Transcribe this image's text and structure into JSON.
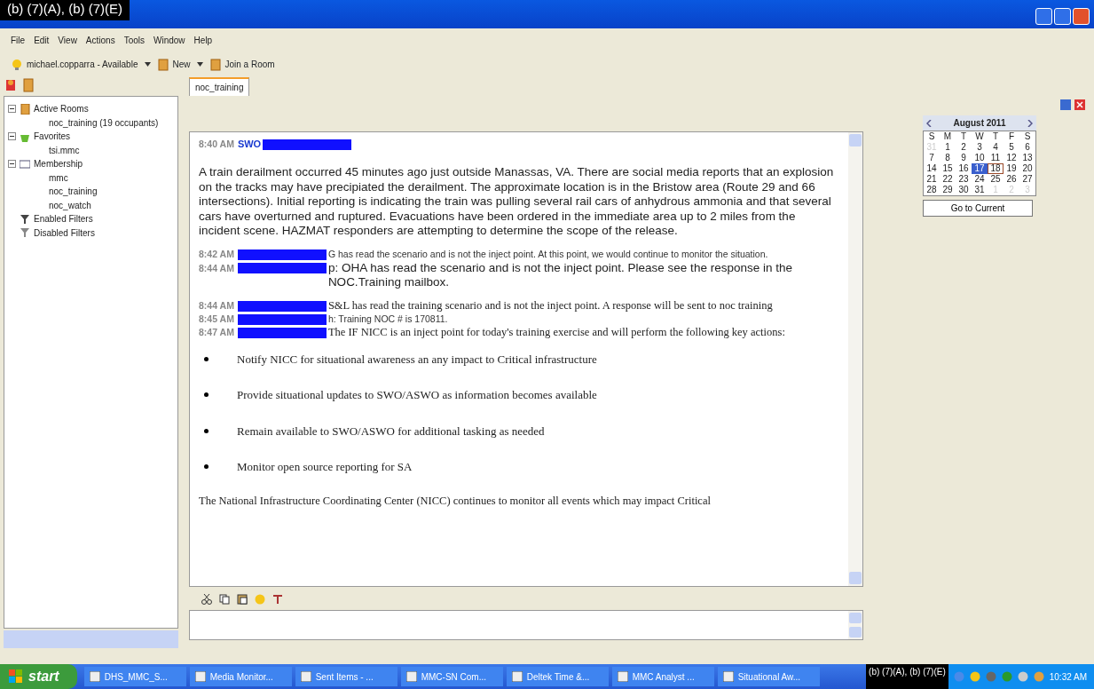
{
  "window": {
    "title_redaction": "(b) (7)(A), (b) (7)(E)"
  },
  "menu": [
    "File",
    "Edit",
    "View",
    "Actions",
    "Tools",
    "Window",
    "Help"
  ],
  "toolbar": {
    "status": "michael.copparra - Available",
    "buttons": [
      "New",
      "Join a Room"
    ]
  },
  "sidebar": {
    "tree": [
      {
        "label": "Active Rooms",
        "kind": "rooms",
        "expanded": true,
        "children": [
          {
            "label": "noc_training (19 occupants)"
          }
        ]
      },
      {
        "label": "Favorites",
        "kind": "favorites",
        "expanded": true,
        "children": [
          {
            "label": "tsi.mmc"
          }
        ]
      },
      {
        "label": "Membership",
        "kind": "membership",
        "expanded": true,
        "children": [
          {
            "label": "mmc"
          },
          {
            "label": "noc_training"
          },
          {
            "label": "noc_watch"
          }
        ]
      },
      {
        "label": "Enabled Filters",
        "kind": "filter"
      },
      {
        "label": "Disabled Filters",
        "kind": "filter-off"
      }
    ]
  },
  "room_tab": {
    "label": "noc_training",
    "selected": true
  },
  "messages": [
    {
      "time": "8:40 AM",
      "sender": "SWO",
      "kind": "header"
    },
    {
      "kind": "large",
      "text": "A train derailment occurred 45 minutes ago just outside Manassas, VA.  There are social media reports that an explosion on the tracks may have precipiated the derailment. The approximate location is in the Bristow area (Route 29 and 66 intersections).  Initial reporting is indicating the train was pulling several rail cars of anhydrous ammonia and that several cars have overturned and ruptured.  Evacuations have been ordered in the immediate area up to 2 miles from the incident scene. HAZMAT responders are attempting to determine the scope of the release."
    },
    {
      "time": "8:42 AM",
      "kind": "small",
      "text": "G has read the scenario and is not the inject point.  At this point, we would continue to monitor the situation."
    },
    {
      "time": "8:44 AM",
      "kind": "large",
      "text": "p: OHA has read the scenario and is not the inject point.  Please see the response in the NOC.Training mailbox."
    },
    {
      "time": "8:44 AM",
      "kind": "serif",
      "text": "S&L has read the training scenario and is not the inject point. A response will be sent to noc training"
    },
    {
      "time": "8:45 AM",
      "kind": "small",
      "text": "h: Training NOC # is 170811."
    },
    {
      "time": "8:47 AM",
      "kind": "serif",
      "text": "The IF NICC is an inject point for today's training exercise and will perform the following key actions:"
    },
    {
      "kind": "bullet",
      "text": "Notify NICC for situational awareness an any impact to Critical infrastructure"
    },
    {
      "kind": "bullet",
      "text": "Provide situational updates to SWO/ASWO as information becomes available"
    },
    {
      "kind": "bullet",
      "text": "Remain available to SWO/ASWO for additional tasking as needed"
    },
    {
      "kind": "bullet",
      "text": "Monitor open source reporting for SA"
    },
    {
      "kind": "serif",
      "text": "The National Infrastructure Coordinating Center (NICC) continues to monitor all events which may impact Critical"
    }
  ],
  "calendar": {
    "month": "August 2011",
    "weekdays": [
      "S",
      "M",
      "T",
      "W",
      "T",
      "F",
      "S"
    ],
    "days": [
      {
        "label": "31",
        "other": true,
        "selected": false,
        "today": false
      },
      {
        "label": "1",
        "other": false,
        "selected": false,
        "today": false
      },
      {
        "label": "2",
        "other": false,
        "selected": false,
        "today": false
      },
      {
        "label": "3",
        "other": false,
        "selected": false,
        "today": false
      },
      {
        "label": "4",
        "other": false,
        "selected": false,
        "today": false
      },
      {
        "label": "5",
        "other": false,
        "selected": false,
        "today": false
      },
      {
        "label": "6",
        "other": false,
        "selected": false,
        "today": false
      },
      {
        "label": "7",
        "other": false,
        "selected": false,
        "today": false
      },
      {
        "label": "8",
        "other": false,
        "selected": false,
        "today": false
      },
      {
        "label": "9",
        "other": false,
        "selected": false,
        "today": false
      },
      {
        "label": "10",
        "other": false,
        "selected": false,
        "today": false
      },
      {
        "label": "11",
        "other": false,
        "selected": false,
        "today": false
      },
      {
        "label": "12",
        "other": false,
        "selected": false,
        "today": false
      },
      {
        "label": "13",
        "other": false,
        "selected": false,
        "today": false
      },
      {
        "label": "14",
        "other": false,
        "selected": false,
        "today": false
      },
      {
        "label": "15",
        "other": false,
        "selected": false,
        "today": false
      },
      {
        "label": "16",
        "other": false,
        "selected": false,
        "today": false
      },
      {
        "label": "17",
        "other": false,
        "selected": true,
        "today": false
      },
      {
        "label": "18",
        "other": false,
        "selected": false,
        "today": true
      },
      {
        "label": "19",
        "other": false,
        "selected": false,
        "today": false
      },
      {
        "label": "20",
        "other": false,
        "selected": false,
        "today": false
      },
      {
        "label": "21",
        "other": false,
        "selected": false,
        "today": false
      },
      {
        "label": "22",
        "other": false,
        "selected": false,
        "today": false
      },
      {
        "label": "23",
        "other": false,
        "selected": false,
        "today": false
      },
      {
        "label": "24",
        "other": false,
        "selected": false,
        "today": false
      },
      {
        "label": "25",
        "other": false,
        "selected": false,
        "today": false
      },
      {
        "label": "26",
        "other": false,
        "selected": false,
        "today": false
      },
      {
        "label": "27",
        "other": false,
        "selected": false,
        "today": false
      },
      {
        "label": "28",
        "other": false,
        "selected": false,
        "today": false
      },
      {
        "label": "29",
        "other": false,
        "selected": false,
        "today": false
      },
      {
        "label": "30",
        "other": false,
        "selected": false,
        "today": false
      },
      {
        "label": "31",
        "other": false,
        "selected": false,
        "today": false
      },
      {
        "label": "1",
        "other": true,
        "selected": false,
        "today": false
      },
      {
        "label": "2",
        "other": true,
        "selected": false,
        "today": false
      },
      {
        "label": "3",
        "other": true,
        "selected": false,
        "today": false
      }
    ],
    "button": "Go to Current"
  },
  "taskbar": {
    "start": "start",
    "items": [
      "DHS_MMC_S...",
      "Media Monitor...",
      "Sent Items - ...",
      "MMC-SN Com...",
      "Deltek Time &...",
      "MMC Analyst ...",
      "Situational Aw..."
    ],
    "tray_redaction": "(b) (7)(A), (b) (7)(E)",
    "clock": "10:32 AM"
  }
}
